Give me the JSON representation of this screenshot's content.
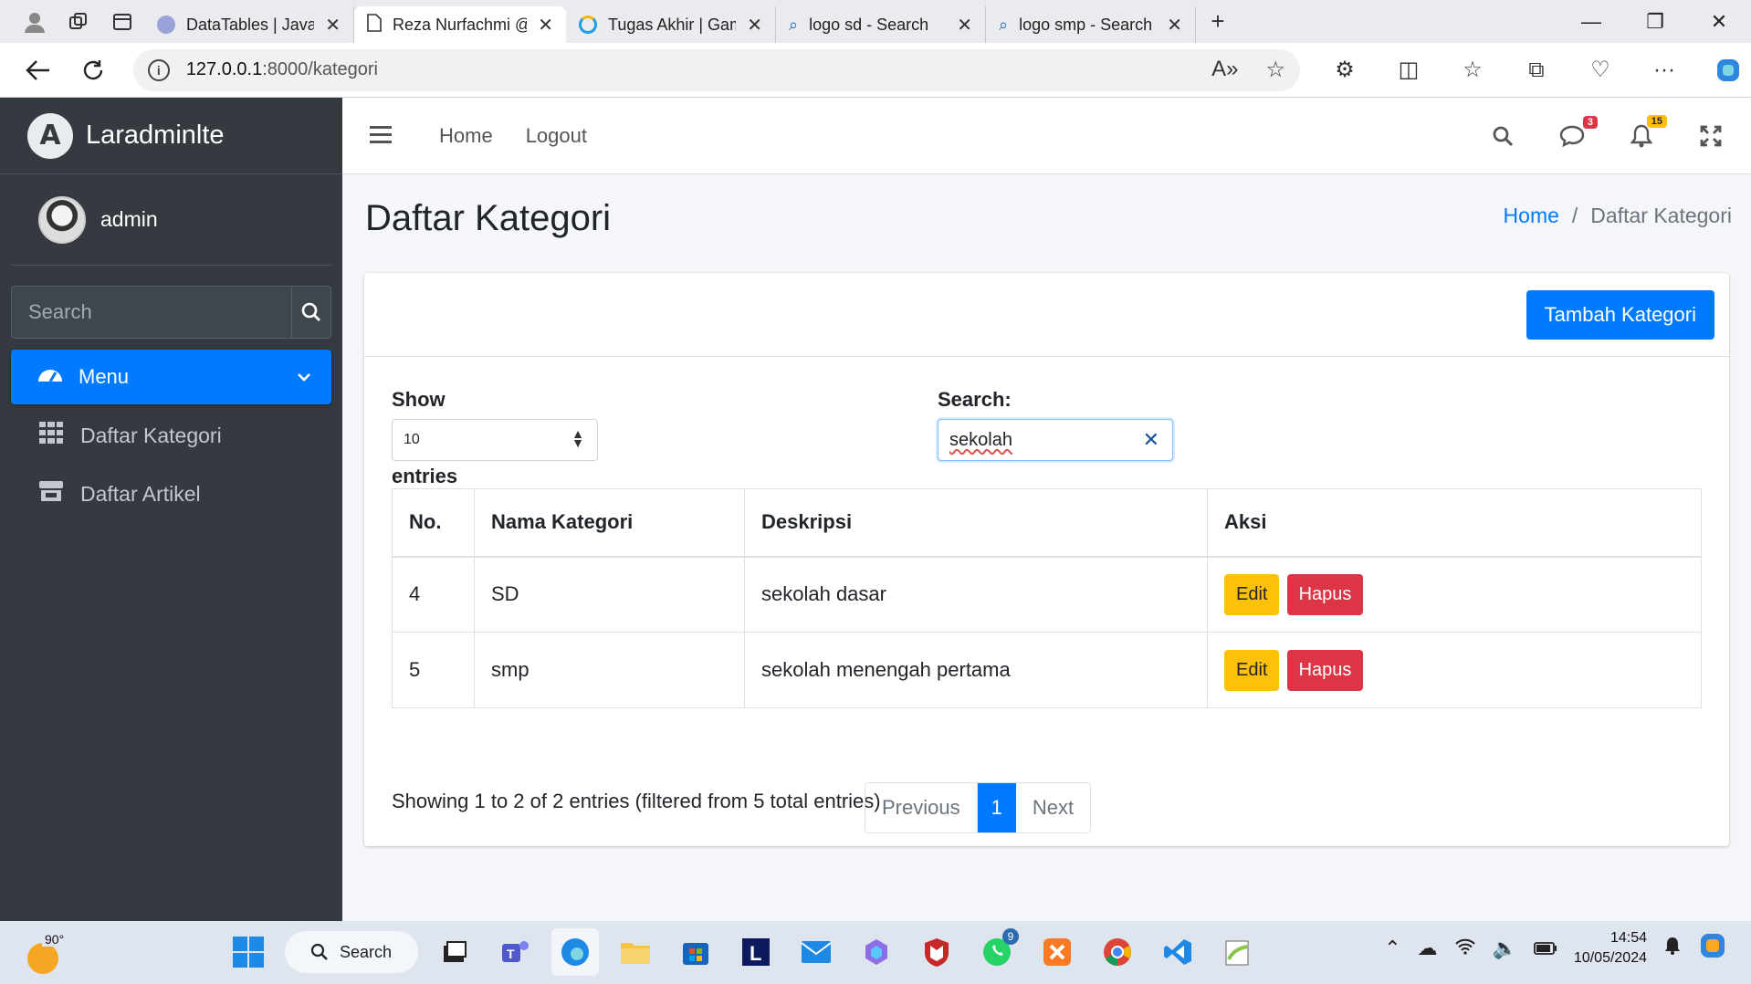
{
  "browser": {
    "tabs": [
      {
        "title": "DataTables | Javascript t",
        "active": false
      },
      {
        "title": "Reza Nurfachmi @ Lara",
        "active": true
      },
      {
        "title": "Tugas Akhir | Gamelab.",
        "active": false
      },
      {
        "title": "logo sd - Search",
        "active": false
      },
      {
        "title": "logo smp - Search Imag",
        "active": false
      }
    ],
    "url_host": "127.0.0.1",
    "url_path": ":8000/kategori"
  },
  "sidebar": {
    "brand": "Laradminlte",
    "user": "admin",
    "search_placeholder": "Search",
    "menu_label": "Menu",
    "items": [
      {
        "label": "Daftar Kategori"
      },
      {
        "label": "Daftar Artikel"
      }
    ]
  },
  "topnav": {
    "links": [
      "Home",
      "Logout"
    ],
    "messages_count": "3",
    "notifications_count": "15"
  },
  "page": {
    "title": "Daftar Kategori",
    "breadcrumb_home": "Home",
    "breadcrumb_sep": "/",
    "breadcrumb_current": "Daftar Kategori",
    "add_button": "Tambah Kategori"
  },
  "datatable": {
    "length_label": "Show",
    "length_value": "10",
    "entries_label": "entries",
    "search_label": "Search:",
    "search_value": "sekolah",
    "columns": [
      "No.",
      "Nama Kategori",
      "Deskripsi",
      "Aksi"
    ],
    "rows": [
      {
        "no": "4",
        "name": "SD",
        "desc": "sekolah dasar"
      },
      {
        "no": "5",
        "name": "smp",
        "desc": "sekolah menengah pertama"
      }
    ],
    "edit_label": "Edit",
    "delete_label": "Hapus",
    "info": "Showing 1 to 2 of 2 entries (filtered from 5 total entries)",
    "pagination": {
      "previous": "Previous",
      "current": "1",
      "next": "Next"
    }
  },
  "taskbar": {
    "temperature": "90°",
    "search_label": "Search",
    "whatsapp_badge": "9",
    "time": "14:54",
    "date": "10/05/2024"
  },
  "colors": {
    "primary": "#007bff",
    "sidebar_bg": "#343a40",
    "warning": "#ffc107",
    "danger": "#dc3545"
  }
}
